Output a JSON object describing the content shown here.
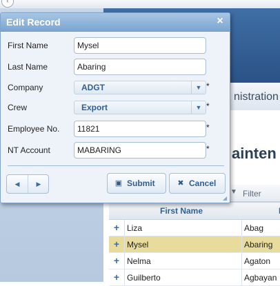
{
  "dialog": {
    "title": "Edit Record",
    "fields": {
      "first_name": {
        "label": "First Name",
        "value": "Mysel"
      },
      "last_name": {
        "label": "Last Name",
        "value": "Abaring"
      },
      "company": {
        "label": "Company",
        "value": "ADGT"
      },
      "crew": {
        "label": "Crew",
        "value": "Export"
      },
      "employee_no": {
        "label": "Employee No.",
        "value": "11821"
      },
      "nt_account": {
        "label": "NT Account",
        "value": "MABARING"
      }
    },
    "required_mark": "*",
    "submit_label": "Submit",
    "cancel_label": "Cancel"
  },
  "background": {
    "admin_tab_text": "nistration",
    "main_title": "ainten",
    "filter_label": "Filter",
    "grid": {
      "columns": [
        "First Name",
        "L"
      ],
      "rows": [
        {
          "first": "Liza",
          "last": "Abag"
        },
        {
          "first": "Mysel",
          "last": "Abaring",
          "selected": true
        },
        {
          "first": "Nelma",
          "last": "Agaton"
        },
        {
          "first": "Guilberto",
          "last": "Agbayan"
        }
      ]
    }
  },
  "colors": {
    "dialog_header": "#7aa5d1",
    "accent_text": "#2f5f93",
    "selected_row": "#e8dc9c",
    "banner": "#2a5286"
  }
}
